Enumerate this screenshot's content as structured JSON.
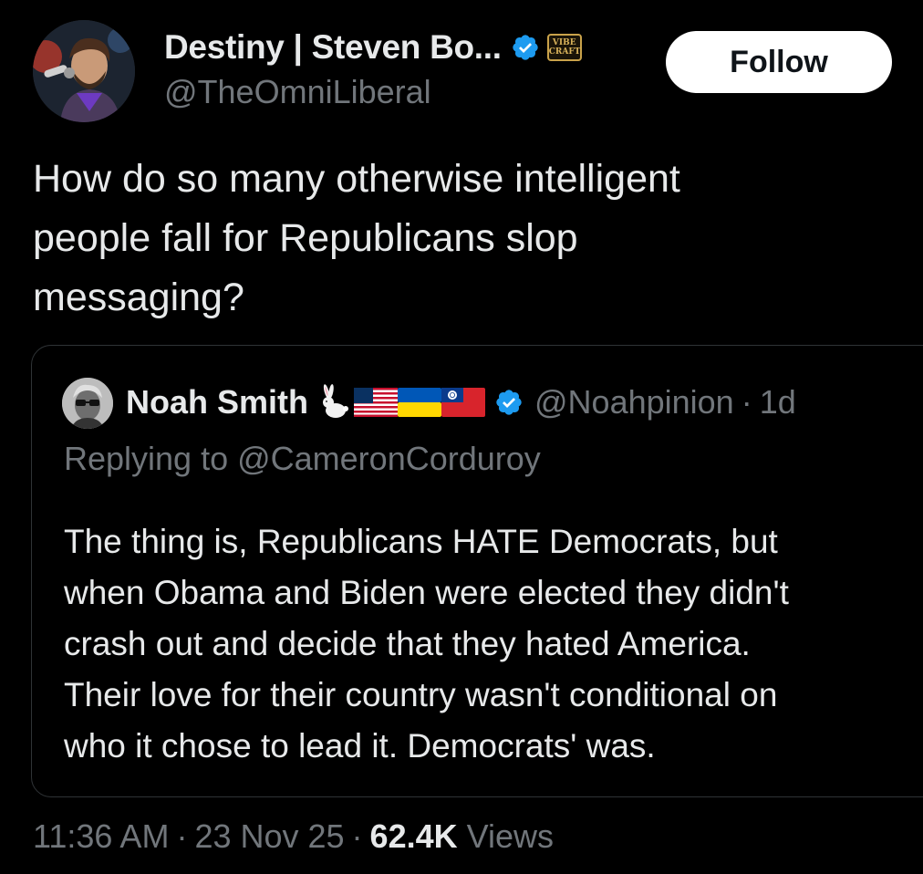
{
  "author": {
    "name": "Destiny | Steven Bo...",
    "handle": "@TheOmniLiberal",
    "verified": true,
    "badge_line1": "VIBE",
    "badge_line2": "CRAFT"
  },
  "follow_button": {
    "label": "Follow"
  },
  "tweet": {
    "lines": [
      "How do so many otherwise intelligent",
      "people fall for Republicans slop",
      "messaging?"
    ]
  },
  "quote": {
    "name": "Noah Smith",
    "handle": "@Noahpinion",
    "separator": "·",
    "time": "1d",
    "verified": true,
    "emojis": [
      "rabbit-icon",
      "us-flag-icon",
      "ukraine-flag-icon",
      "taiwan-flag-icon"
    ],
    "replying_to": "Replying to @CameronCorduroy",
    "lines": [
      "The thing is, Republicans HATE Democrats, but",
      "when Obama and Biden were elected they didn't",
      "crash out and decide that they hated America.",
      "Their love for their country wasn't conditional on",
      "who it chose to lead it. Democrats' was."
    ]
  },
  "meta": {
    "time": "11:36 AM",
    "separator": "·",
    "date": "23 Nov 25",
    "views_count": "62.4K",
    "views_label": "Views"
  },
  "colors": {
    "background": "#000000",
    "text": "#e7e9ea",
    "muted": "#71767b",
    "verified_blue": "#1d9bf0",
    "border": "#2f3336"
  }
}
